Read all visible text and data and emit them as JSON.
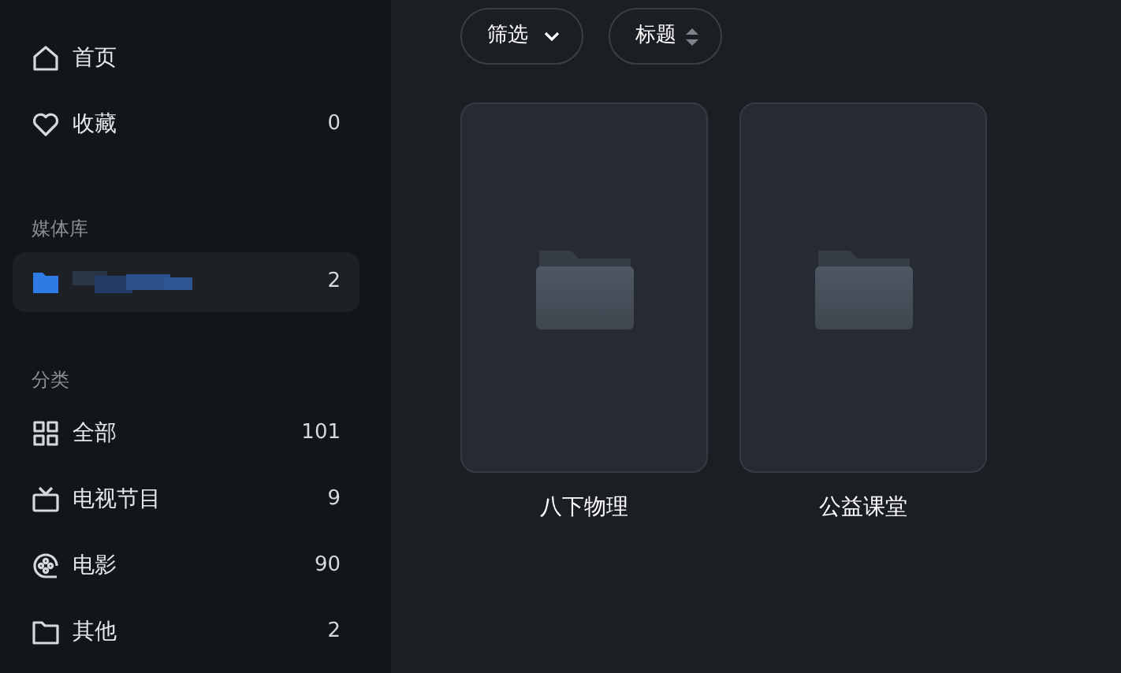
{
  "sidebar": {
    "top_items": [
      {
        "label": "首页",
        "selected": false
      },
      {
        "label": "收藏",
        "count": "0",
        "selected": false
      }
    ],
    "library": {
      "heading": "媒体库",
      "items": [
        {
          "count": "2",
          "selected": true
        }
      ]
    },
    "categories": {
      "heading": "分类",
      "items": [
        {
          "label": "全部",
          "count": "101",
          "selected": false
        },
        {
          "label": "电视节目",
          "count": "9",
          "selected": false
        },
        {
          "label": "电影",
          "count": "90",
          "selected": false
        },
        {
          "label": "其他",
          "count": "2",
          "selected": false
        }
      ]
    }
  },
  "toolbar": {
    "filter": "筛选",
    "sort": "标题"
  },
  "folders": [
    {
      "title": "八下物理"
    },
    {
      "title": "公益课堂"
    }
  ]
}
